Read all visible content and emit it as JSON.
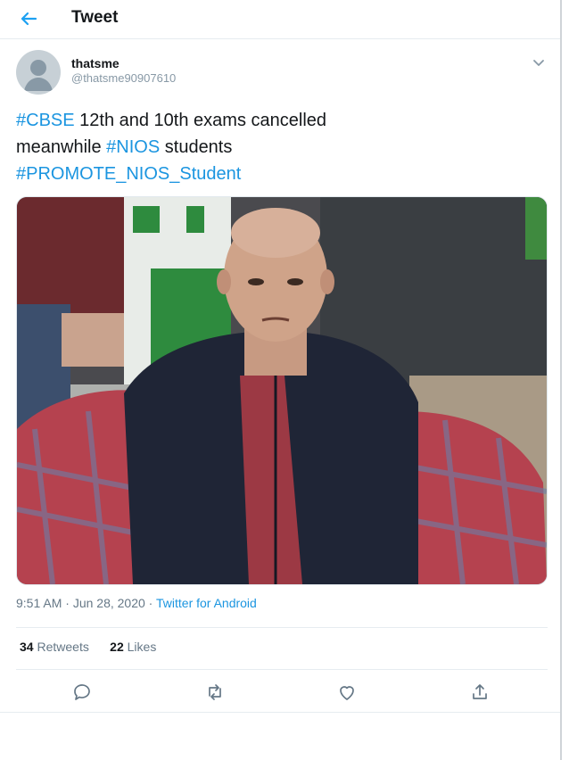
{
  "header": {
    "title": "Tweet"
  },
  "author": {
    "display_name": "thatsme",
    "handle": "@thatsme90907610"
  },
  "tweet": {
    "segments": [
      {
        "tag": "#CBSE",
        "text": " 12th and 10th exams cancelled"
      },
      {
        "text": "meanwhile ",
        "tag": "#NIOS",
        "tail": " students"
      },
      {
        "tag": "#PROMOTE_NIOS_Student"
      }
    ]
  },
  "meta": {
    "time": "9:51 AM",
    "separator1": " · ",
    "date": "Jun 28, 2020",
    "separator2": " · ",
    "source": "Twitter for Android"
  },
  "stats": {
    "retweets_count": "34",
    "retweets_label": "Retweets",
    "likes_count": "22",
    "likes_label": "Likes"
  },
  "icons": {
    "back": "back-arrow-icon",
    "caret": "chevron-down-icon",
    "reply": "reply-icon",
    "retweet": "retweet-icon",
    "like": "heart-icon",
    "share": "share-icon"
  },
  "colors": {
    "link": "#1b95e0",
    "text": "#14171a",
    "muted": "#657786",
    "divider": "#e6ecf0"
  }
}
